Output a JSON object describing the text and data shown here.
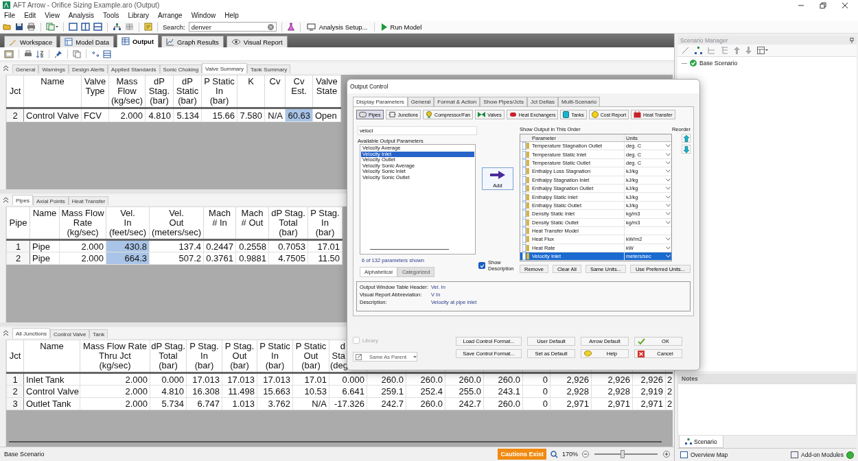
{
  "window": {
    "title": "AFT Arrow - Orifice Sizing Example.aro (Output)"
  },
  "menu": [
    "File",
    "Edit",
    "View",
    "Analysis",
    "Tools",
    "Library",
    "Arrange",
    "Window",
    "Help"
  ],
  "toolbar": {
    "search_label": "Search:",
    "search_value": "denver",
    "analysis_setup": "Analysis Setup...",
    "run_model": "Run Model"
  },
  "main_tabs": [
    {
      "label": "Workspace",
      "kind": "workspace",
      "selected": false
    },
    {
      "label": "Model Data",
      "kind": "data",
      "selected": false
    },
    {
      "label": "Output",
      "kind": "output",
      "selected": true
    },
    {
      "label": "Graph Results",
      "kind": "graph",
      "selected": false
    },
    {
      "label": "Visual Report",
      "kind": "report",
      "selected": false
    }
  ],
  "sections": [
    {
      "tabs": [
        {
          "label": "General",
          "selected": false
        },
        {
          "label": "Warnings",
          "selected": false
        },
        {
          "label": "Design Alerts",
          "selected": false
        },
        {
          "label": "Applied Standards",
          "selected": false
        },
        {
          "label": "Sonic Choking",
          "selected": false
        },
        {
          "label": "Valve Summary",
          "selected": true
        },
        {
          "label": "Tank Summary",
          "selected": false
        }
      ],
      "table": {
        "columns": [
          {
            "label": [
              "Jct"
            ],
            "selected": false
          },
          {
            "label": [
              "Name"
            ],
            "selected": false
          },
          {
            "label": [
              "Valve",
              "Type"
            ],
            "selected": false
          },
          {
            "label": [
              "Mass",
              "Flow",
              "(kg/sec)"
            ],
            "selected": false
          },
          {
            "label": [
              "dP",
              "Stag.",
              "(bar)"
            ],
            "selected": false
          },
          {
            "label": [
              "dP",
              "Static",
              "(bar)"
            ],
            "selected": false
          },
          {
            "label": [
              "P Static",
              "In",
              "(bar)"
            ],
            "selected": false
          },
          {
            "label": [
              "K"
            ],
            "selected": false
          },
          {
            "label": [
              "Cv"
            ],
            "selected": false
          },
          {
            "label": [
              "Cv",
              "Est."
            ],
            "selected": true
          },
          {
            "label": [
              "Valve",
              "State"
            ],
            "selected": false
          }
        ],
        "rows": [
          [
            "2",
            "Control Valve",
            "FCV",
            "2.000",
            "4.810",
            "5.134",
            "15.66",
            "7.580",
            "N/A",
            "60.63",
            "Open"
          ]
        ]
      }
    },
    {
      "tabs": [
        {
          "label": "Pipes",
          "selected": true
        },
        {
          "label": "Axial Points",
          "selected": false
        },
        {
          "label": "Heat Transfer",
          "selected": false
        }
      ],
      "table": {
        "columns": [
          {
            "label": [
              "Pipe"
            ],
            "selected": false
          },
          {
            "label": [
              "Name"
            ],
            "selected": false
          },
          {
            "label": [
              "Mass Flow",
              "Rate",
              "(kg/sec)"
            ],
            "selected": false
          },
          {
            "label": [
              "Vel.",
              "In",
              "(feet/sec)"
            ],
            "selected": true
          },
          {
            "label": [
              "Vel.",
              "Out",
              "(meters/sec)"
            ],
            "selected": false
          },
          {
            "label": [
              "Mach",
              "# In"
            ],
            "selected": false
          },
          {
            "label": [
              "Mach",
              "# Out"
            ],
            "selected": false
          },
          {
            "label": [
              "dP Stag.",
              "Total",
              "(bar)"
            ],
            "selected": false
          },
          {
            "label": [
              "P Stag.",
              "In",
              "(bar)"
            ],
            "selected": false
          }
        ],
        "rows": [
          [
            "1",
            "Pipe",
            "2.000",
            "430.8",
            "137.4",
            "0.2447",
            "0.2558",
            "0.7053",
            "17.01"
          ],
          [
            "2",
            "Pipe",
            "2.000",
            "664.3",
            "507.2",
            "0.3761",
            "0.9881",
            "4.7505",
            "11.50"
          ]
        ]
      }
    },
    {
      "tabs": [
        {
          "label": "All Junctions",
          "selected": true
        },
        {
          "label": "Control Valve",
          "selected": false
        },
        {
          "label": "Tank",
          "selected": false
        }
      ],
      "table": {
        "columns": [
          {
            "label": [
              "Jct"
            ],
            "selected": false
          },
          {
            "label": [
              "Name"
            ],
            "selected": false
          },
          {
            "label": [
              "Mass Flow Rate",
              "Thru Jct",
              "(kg/sec)"
            ],
            "selected": false
          },
          {
            "label": [
              "dP Stag.",
              "Total",
              "(bar)"
            ],
            "selected": false
          },
          {
            "label": [
              "P Stag.",
              "In",
              "(bar)"
            ],
            "selected": false
          },
          {
            "label": [
              "P Stag.",
              "Out",
              "(bar)"
            ],
            "selected": false
          },
          {
            "label": [
              "P Static",
              "In",
              "(bar)"
            ],
            "selected": false
          },
          {
            "label": [
              "P Static",
              "Out",
              "(bar)"
            ],
            "selected": false
          },
          {
            "label": [
              "d",
              "Sta",
              "(deg"
            ],
            "selected": false
          }
        ],
        "rows": [
          [
            "1",
            "Inlet Tank",
            "2.000",
            "0.000",
            "17.013",
            "17.013",
            "17.013",
            "17.01",
            "0.000",
            "260.0",
            "260.0",
            "260.0",
            "260.0",
            "0",
            "2,926",
            "2,926",
            "2,926",
            "2"
          ],
          [
            "2",
            "Control Valve",
            "2.000",
            "4.810",
            "16.308",
            "11.498",
            "15.663",
            "10.53",
            "6.641",
            "259.1",
            "252.4",
            "255.0",
            "243.1",
            "0",
            "2,928",
            "2,928",
            "2,919",
            "2"
          ],
          [
            "3",
            "Outlet Tank",
            "2.000",
            "5.734",
            "6.747",
            "1.013",
            "3.762",
            "N/A",
            "-17.326",
            "242.7",
            "260.0",
            "242.7",
            "260.0",
            "0",
            "2,971",
            "2,971",
            "2,971",
            "2"
          ]
        ]
      }
    }
  ],
  "status_bar": {
    "scenario": "Base Scenario",
    "caution": "Cautions Exist",
    "zoom": "170%",
    "zoom_slider": {
      "level": 0.45
    }
  },
  "scenario_manager": {
    "title": "Scenario Manager",
    "tree": [
      "Base Scenario"
    ],
    "notes_title": "Notes",
    "tabs": [
      {
        "label": "Scenario",
        "selected": true
      }
    ],
    "bottom": [
      "Overview Map",
      "Add-on Modules"
    ]
  },
  "output_control": {
    "title": "Output Control",
    "tabs": [
      {
        "label": "Display Parameters",
        "selected": true
      },
      {
        "label": "General",
        "selected": false
      },
      {
        "label": "Format & Action",
        "selected": false
      },
      {
        "label": "Show Pipes/Jcts",
        "selected": false
      },
      {
        "label": "Jct Deltas",
        "selected": false
      },
      {
        "label": "Multi-Scenario",
        "selected": false
      }
    ],
    "categories": [
      {
        "label": "Pipes",
        "kind": "pipe",
        "selected": true
      },
      {
        "label": "Junctions",
        "kind": "junction",
        "selected": false
      },
      {
        "label": "Compressor/Fan",
        "kind": "fan",
        "selected": false
      },
      {
        "label": "Valves",
        "kind": "valve",
        "selected": false
      },
      {
        "label": "Heat Exchangers",
        "kind": "exchanger",
        "selected": false
      },
      {
        "label": "Tanks",
        "kind": "tank",
        "selected": false
      },
      {
        "label": "Cost Report",
        "kind": "cost",
        "selected": false
      },
      {
        "label": "Heat Transfer",
        "kind": "heat",
        "selected": false
      }
    ],
    "filter": "veloci",
    "available_label": "Available Output Parameters",
    "available": [
      {
        "label": "Velocity Average",
        "selected": false
      },
      {
        "label": "Velocity Inlet",
        "selected": true
      },
      {
        "label": "Velocity Outlet",
        "selected": false
      },
      {
        "label": "Velocity Sonic Average",
        "selected": false
      },
      {
        "label": "Velocity Sonic Inlet",
        "selected": false
      },
      {
        "label": "Velocity Sonic Outlet",
        "selected": false
      }
    ],
    "count": "6 of 132 parameters shown",
    "list_tabs": [
      {
        "label": "Alphabetical",
        "selected": true
      },
      {
        "label": "Categorized",
        "selected": false
      }
    ],
    "add_button": "Add",
    "show_description": {
      "label": "Show Description",
      "checked": true
    },
    "order_label": "Show Output in This Order",
    "reorder_label": "Reorder",
    "order_columns": [
      "Parameter",
      "Units"
    ],
    "order_rows": [
      {
        "parameter": "Temperature Stagnation Outlet",
        "units": "deg. C",
        "selected": false
      },
      {
        "parameter": "Temperature Static Inlet",
        "units": "deg. C",
        "selected": false
      },
      {
        "parameter": "Temperature Static Outlet",
        "units": "deg. C",
        "selected": false
      },
      {
        "parameter": "Enthalpy Loss Stagnation",
        "units": "kJ/kg",
        "selected": false
      },
      {
        "parameter": "Enthalpy Stagnation Inlet",
        "units": "kJ/kg",
        "selected": false
      },
      {
        "parameter": "Enthalpy Stagnation Outlet",
        "units": "kJ/kg",
        "selected": false
      },
      {
        "parameter": "Enthalpy Static Inlet",
        "units": "kJ/kg",
        "selected": false
      },
      {
        "parameter": "Enthalpy Static Outlet",
        "units": "kJ/kg",
        "selected": false
      },
      {
        "parameter": "Density Static Inlet",
        "units": "kg/m3",
        "selected": false
      },
      {
        "parameter": "Density Static Outlet",
        "units": "kg/m3",
        "selected": false
      },
      {
        "parameter": "Heat Transfer Model",
        "selected": false
      },
      {
        "parameter": "Heat Flux",
        "units": "kW/m2",
        "selected": false
      },
      {
        "parameter": "Heat Rate",
        "units": "kW",
        "selected": false
      },
      {
        "parameter": "Velocity Inlet",
        "units": "meters/sec",
        "selected": true
      }
    ],
    "row_buttons": [
      "Remove",
      "Clear All",
      "Same Units...",
      "Use Preferred Units..."
    ],
    "description": [
      {
        "label": "Output Window Table Header:",
        "value": "Vel. In"
      },
      {
        "label": "Visual Report Abbreviation:",
        "value": "V In"
      },
      {
        "label": "Description:",
        "value": "Velocity at pipe inlet"
      }
    ],
    "library": {
      "label": "Library",
      "checked": false,
      "disabled": true
    },
    "format_select": "Same As Parent",
    "buttons": [
      {
        "label": "Load Control Format...",
        "kind": "plain"
      },
      {
        "label": "User Default",
        "kind": "plain"
      },
      {
        "label": "Arrow Default",
        "kind": "plain"
      },
      {
        "label": "OK",
        "kind": "ok"
      },
      {
        "label": "Save Control Format...",
        "kind": "plain"
      },
      {
        "label": "Set as Default",
        "kind": "plain"
      },
      {
        "label": "Help",
        "kind": "help"
      },
      {
        "label": "Cancel",
        "kind": "cancel"
      }
    ]
  }
}
